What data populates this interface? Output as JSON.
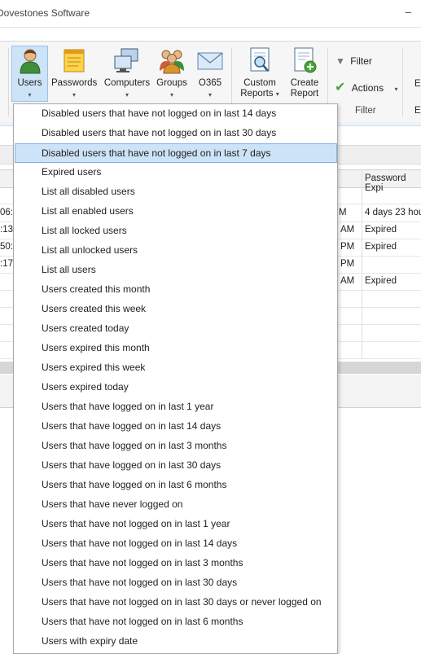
{
  "window": {
    "title": "Dovestones Software",
    "minimize_glyph": "–"
  },
  "ribbon": {
    "buttons": [
      {
        "label": "Users",
        "icon": "user-icon"
      },
      {
        "label": "Passwords",
        "icon": "notepad-icon"
      },
      {
        "label": "Computers",
        "icon": "computers-icon"
      },
      {
        "label": "Groups",
        "icon": "groups-icon"
      },
      {
        "label": "O365",
        "icon": "mail-icon"
      },
      {
        "label": "Custom Reports",
        "label1": "Custom",
        "label2": "Reports",
        "icon": "custom-report-icon"
      },
      {
        "label": "Create Report",
        "label1": "Create",
        "label2": "Report",
        "icon": "create-report-icon"
      }
    ],
    "filter_label": "Filter",
    "actions_label": "Actions",
    "filter_group_label": "Filter",
    "cut_labels": {
      "top": "E",
      "bottom": "E"
    }
  },
  "grid": {
    "header_right": "Password Expi",
    "rows": [
      {
        "left": "06:",
        "mid": "M",
        "right": "4 days 23 hou"
      },
      {
        "left": ":13",
        "mid": "AM",
        "right": "Expired"
      },
      {
        "left": "50:",
        "mid": "PM",
        "right": "Expired"
      },
      {
        "left": ":17",
        "mid": "PM",
        "right": ""
      },
      {
        "left": "",
        "mid": "AM",
        "right": "Expired"
      }
    ]
  },
  "dropdown": {
    "selected_index": 2,
    "items": [
      "Disabled users that have not logged on in last 14 days",
      "Disabled users that have not logged on in last 30 days",
      "Disabled users that have not logged on in last 7 days",
      "Expired users",
      "List all disabled users",
      "List all enabled users",
      "List all locked users",
      "List all unlocked users",
      "List all users",
      "Users created this month",
      "Users created this week",
      "Users created today",
      "Users expired this month",
      "Users expired this week",
      "Users expired today",
      "Users that have logged on in last 1 year",
      "Users that have logged on in last 14 days",
      "Users that have logged on in last 3 months",
      "Users that have logged on in last 30 days",
      "Users that have logged on in last 6 months",
      "Users that have never logged on",
      "Users that have not logged on in last 1 year",
      "Users that have not logged on in last 14 days",
      "Users that have not logged on in last 3 months",
      "Users that have not logged on in last 30 days",
      "Users that have not logged on in last 30 days or never logged on",
      "Users that have not logged on in last 6 months",
      "Users with expiry date"
    ]
  },
  "colors": {
    "selection": "#cde3f7",
    "selection_border": "#7eb4ea",
    "accent_green": "#4aa33a"
  }
}
